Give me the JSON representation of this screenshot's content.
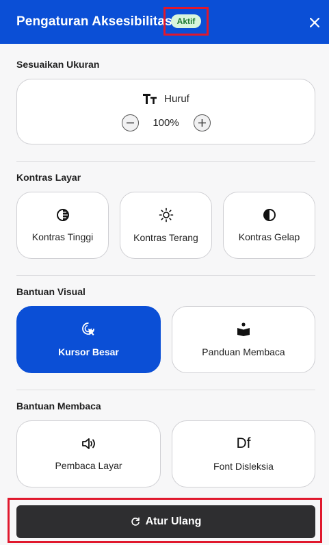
{
  "header": {
    "title": "Pengaturan Aksesibilitas",
    "status_badge": "Aktif",
    "close_icon": "close-icon"
  },
  "size_section": {
    "title": "Sesuaikan Ukuran",
    "font_label": "Huruf",
    "font_icon": "text-size-icon",
    "zoom_value": "100%",
    "decrease_icon": "minus-circle-icon",
    "increase_icon": "plus-circle-icon"
  },
  "contrast_section": {
    "title": "Kontras Layar",
    "options": [
      {
        "label": "Kontras Tinggi",
        "icon": "high-contrast-icon"
      },
      {
        "label": "Kontras Terang",
        "icon": "sun-icon"
      },
      {
        "label": "Kontras Gelap",
        "icon": "half-circle-icon"
      }
    ]
  },
  "visual_section": {
    "title": "Bantuan Visual",
    "options": [
      {
        "label": "Kursor Besar",
        "icon": "cursor-click-icon",
        "active": true
      },
      {
        "label": "Panduan Membaca",
        "icon": "reading-guide-icon",
        "active": false
      }
    ]
  },
  "reading_section": {
    "title": "Bantuan Membaca",
    "options": [
      {
        "label": "Pembaca Layar",
        "icon": "speaker-icon"
      },
      {
        "label": "Font Disleksia",
        "icon": "dyslexia-font-icon",
        "glyph": "Df"
      }
    ]
  },
  "reset": {
    "label": "Atur Ulang",
    "icon": "reset-icon"
  },
  "colors": {
    "primary": "#0b4fd6",
    "badge_bg": "#d9f5dc",
    "badge_text": "#1e7b34",
    "highlight": "#e0182d",
    "reset_bg": "#2e2e30"
  }
}
